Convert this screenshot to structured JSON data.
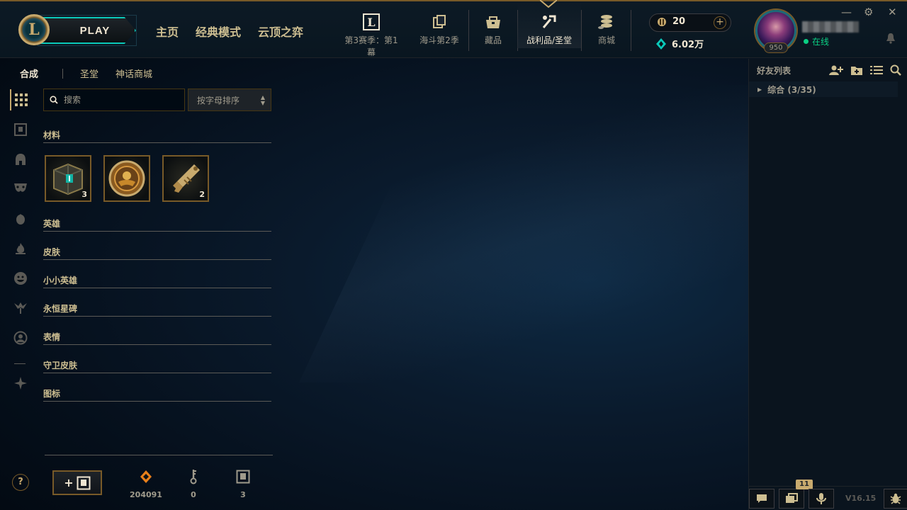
{
  "header": {
    "logo_letter": "L",
    "play_label": "PLAY",
    "nav_main": [
      "主页",
      "经典模式",
      "云顶之弈"
    ],
    "nav_icons": [
      {
        "label": "第3赛季：第1幕",
        "icon": "season-pass-icon"
      },
      {
        "label": "海斗第2季",
        "icon": "event-icon"
      },
      {
        "label": "藏品",
        "icon": "collection-icon"
      },
      {
        "label": "战利品/圣堂",
        "icon": "loot-icon"
      },
      {
        "label": "商城",
        "icon": "store-icon"
      }
    ],
    "rp_amount": "20",
    "be_amount": "6.02万",
    "add_currency": "+",
    "level": "950",
    "status": "在线",
    "minimize": "—",
    "settings": "⚙",
    "close": "✕"
  },
  "loot": {
    "subtabs": [
      "合成",
      "圣堂",
      "神话商城"
    ],
    "search_placeholder": "搜索",
    "sort_label": "按字母排序",
    "categories": [
      "材料",
      "英雄",
      "皮肤",
      "小小英雄",
      "永恒星碑",
      "表情",
      "守卫皮肤",
      "图标"
    ],
    "materials": [
      {
        "name": "chest",
        "count": "3"
      },
      {
        "name": "mythic-essence-token",
        "count": ""
      },
      {
        "name": "key",
        "count": "2"
      }
    ],
    "help": "?",
    "craft_plus": "+",
    "resources": [
      {
        "icon": "orange-essence-icon",
        "value": "204091"
      },
      {
        "icon": "key-fragment-icon",
        "value": "0"
      },
      {
        "icon": "chest-icon",
        "value": "3"
      }
    ]
  },
  "social": {
    "title": "好友列表",
    "group": "综合 (3/35)",
    "notification_count": "11",
    "version": "V16.15"
  },
  "colors": {
    "gold": "#c8aa6e",
    "gold_dark": "#785a28",
    "text_light": "#f0e6d2",
    "online_green": "#0acf83",
    "teal": "#0ac8b9"
  }
}
